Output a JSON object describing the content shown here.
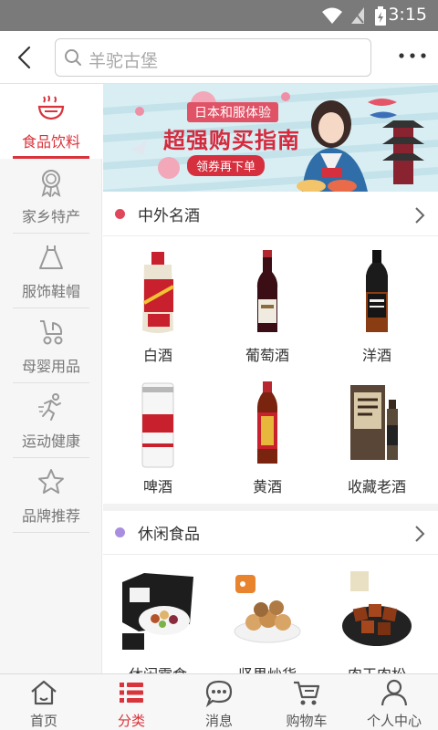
{
  "status_bar": {
    "time": "3:15"
  },
  "header": {
    "search_placeholder": "羊驼古堡"
  },
  "colors": {
    "accent": "#d9333b",
    "dot_wine": "#e0475a",
    "dot_snack": "#a98ee0"
  },
  "sidebar": {
    "items": [
      {
        "label": "食品饮料",
        "icon": "noodle-bowl-icon",
        "active": true
      },
      {
        "label": "家乡特产",
        "icon": "award-ribbon-icon"
      },
      {
        "label": "服饰鞋帽",
        "icon": "dress-icon"
      },
      {
        "label": "母婴用品",
        "icon": "stroller-icon"
      },
      {
        "label": "运动健康",
        "icon": "running-icon"
      },
      {
        "label": "品牌推荐",
        "icon": "star-icon"
      }
    ]
  },
  "banner": {
    "line1": "日本和服体验",
    "line2": "超强购买指南",
    "button": "领券再下单"
  },
  "sections": [
    {
      "title": "中外名酒",
      "items": [
        {
          "name": "白酒",
          "icon": "baijiu-bottle"
        },
        {
          "name": "葡萄酒",
          "icon": "wine-bottle"
        },
        {
          "name": "洋酒",
          "icon": "whiskey-bottle"
        },
        {
          "name": "啤酒",
          "icon": "beer-can"
        },
        {
          "name": "黄酒",
          "icon": "huangjiu-bottle"
        },
        {
          "name": "收藏老酒",
          "icon": "aged-liquor-box"
        }
      ]
    },
    {
      "title": "休闲食品",
      "items": [
        {
          "name": "休闲零食",
          "icon": "snack-gift-box"
        },
        {
          "name": "坚果炒货",
          "icon": "nuts-bowl"
        },
        {
          "name": "肉干肉松",
          "icon": "jerky-bowl"
        }
      ]
    }
  ],
  "bottom_nav": {
    "items": [
      {
        "label": "首页",
        "icon": "home-icon"
      },
      {
        "label": "分类",
        "icon": "category-list-icon",
        "active": true
      },
      {
        "label": "消息",
        "icon": "message-icon"
      },
      {
        "label": "购物车",
        "icon": "cart-icon"
      },
      {
        "label": "个人中心",
        "icon": "user-icon"
      }
    ]
  }
}
